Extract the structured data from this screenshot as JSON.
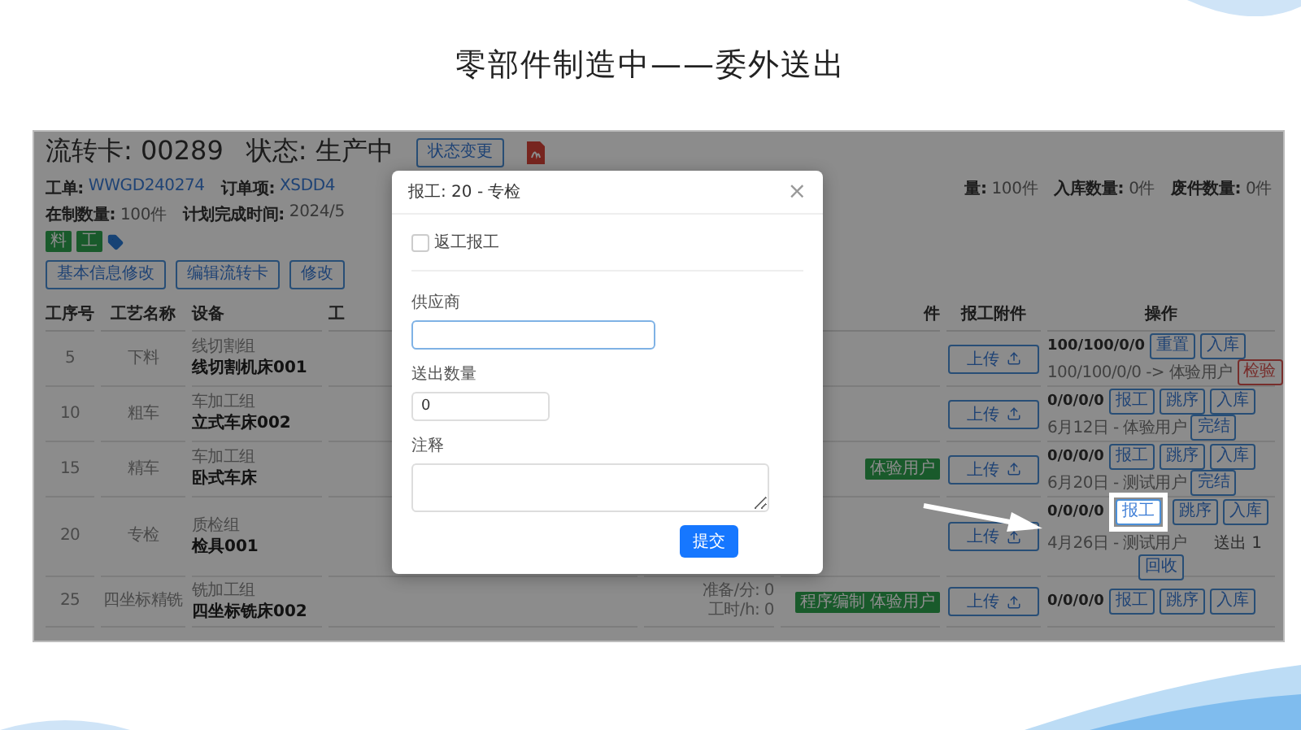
{
  "slide_title": "零部件制造中——委外送出",
  "card": {
    "label": "流转卡:",
    "number": "00289",
    "status_label": "状态:",
    "status": "生产中",
    "status_button": "状态变更"
  },
  "info_rows": [
    {
      "items": [
        {
          "label": "工单:",
          "value": "WWGD240274",
          "link": true
        },
        {
          "label": "订单项:",
          "value": "XSDD4",
          "link": true
        }
      ]
    },
    {
      "items": [
        {
          "label": "在制数量:",
          "value": "100件",
          "link": false
        },
        {
          "label": "计划完成时间:",
          "value": "2024/5",
          "link": false
        }
      ]
    }
  ],
  "info_right": [
    {
      "label": "量:",
      "value": "100件"
    },
    {
      "label": "入库数量:",
      "value": "0件"
    },
    {
      "label": "废件数量:",
      "value": "0件"
    }
  ],
  "tags": [
    "料",
    "工"
  ],
  "actions": [
    "基本信息修改",
    "编辑流转卡",
    "修改"
  ],
  "columns_left": [
    "工序号",
    "工艺名称",
    "设备",
    "工"
  ],
  "columns_right": [
    "件",
    "报工附件",
    "操作"
  ],
  "rows": [
    {
      "seq": "5",
      "process": "下料",
      "group": "线切割组",
      "equipment": "线切割机床001",
      "upload": "上传",
      "counts": "100/100/0/0",
      "buttons": [
        {
          "label": "重置",
          "kind": "normal",
          "highlighted": false
        },
        {
          "label": "入库",
          "kind": "normal",
          "highlighted": false
        }
      ],
      "history": "100/100/0/0 -> 体验用户",
      "side_buttons": [
        {
          "label": "检验",
          "kind": "danger",
          "highlighted": false
        }
      ]
    },
    {
      "seq": "10",
      "process": "粗车",
      "group": "车加工组",
      "equipment": "立式车床002",
      "upload": "上传",
      "counts": "0/0/0/0",
      "buttons": [
        {
          "label": "报工",
          "kind": "normal",
          "highlighted": false
        },
        {
          "label": "跳序",
          "kind": "normal",
          "highlighted": false
        },
        {
          "label": "入库",
          "kind": "normal",
          "highlighted": false
        }
      ],
      "history": "6月12日 - 体验用户",
      "side_buttons": [
        {
          "label": "完结",
          "kind": "normal",
          "highlighted": false
        }
      ]
    },
    {
      "seq": "15",
      "process": "精车",
      "group": "车加工组",
      "equipment": "卧式车床",
      "tags": [
        "体验用户"
      ],
      "upload": "上传",
      "counts": "0/0/0/0",
      "buttons": [
        {
          "label": "报工",
          "kind": "normal",
          "highlighted": false
        },
        {
          "label": "跳序",
          "kind": "normal",
          "highlighted": false
        },
        {
          "label": "入库",
          "kind": "normal",
          "highlighted": false
        }
      ],
      "history": "6月20日 - 测试用户",
      "side_buttons": [
        {
          "label": "完结",
          "kind": "normal",
          "highlighted": false
        }
      ]
    },
    {
      "seq": "20",
      "process": "专检",
      "group": "质检组",
      "equipment": "检具001",
      "upload": "上传",
      "counts": "0/0/0/0",
      "buttons": [
        {
          "label": "报工",
          "kind": "normal",
          "highlighted": true
        },
        {
          "label": "跳序",
          "kind": "normal",
          "highlighted": false
        },
        {
          "label": "入库",
          "kind": "normal",
          "highlighted": false
        }
      ],
      "history": "4月26日 - 测试用户",
      "note": "送出 1",
      "bottom_buttons": [
        {
          "label": "回收",
          "kind": "normal",
          "highlighted": false
        }
      ]
    },
    {
      "seq": "25",
      "process": "四坐标精铣",
      "group": "铣加工组",
      "equipment": "四坐标铣床002",
      "prep": [
        "准备/分: 0",
        "工时/h: 0"
      ],
      "tags": [
        "程序编制 体验用户"
      ],
      "upload": "上传",
      "counts": "0/0/0/0",
      "buttons": [
        {
          "label": "报工",
          "kind": "normal",
          "highlighted": false
        },
        {
          "label": "跳序",
          "kind": "normal",
          "highlighted": false
        },
        {
          "label": "入库",
          "kind": "normal",
          "highlighted": false
        }
      ]
    }
  ],
  "modal": {
    "title": "报工: 20 - 专检",
    "close": "×",
    "rework": {
      "label": "返工报工",
      "checked": false
    },
    "fields": [
      {
        "kind": "input",
        "label": "供应商",
        "focused": true
      },
      {
        "kind": "input",
        "label": "送出数量",
        "value": "0",
        "focused": false
      },
      {
        "kind": "textarea",
        "label": "注释",
        "focused": false
      }
    ],
    "submit": "提交"
  }
}
